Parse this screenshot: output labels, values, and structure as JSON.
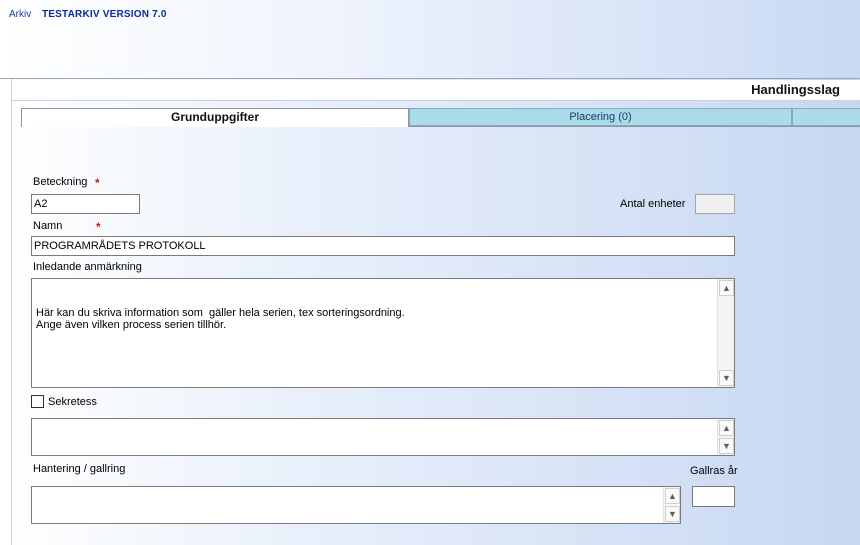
{
  "menu": {
    "arkiv_label": "Arkiv"
  },
  "app": {
    "title": "TESTARKIV VERSION 7.0"
  },
  "header": {
    "title": "Handlingsslag"
  },
  "tabs": [
    {
      "label": "Grunduppgifter",
      "active": true
    },
    {
      "label": "Placering (0)",
      "active": false
    },
    {
      "label": "",
      "active": false
    }
  ],
  "form": {
    "beteckning": {
      "label": "Beteckning",
      "required_mark": "*",
      "value": "A2"
    },
    "antal_enheter": {
      "label": "Antal enheter",
      "value": ""
    },
    "namn": {
      "label": "Namn",
      "required_mark": "*",
      "value": "PROGRAMRÅDETS PROTOKOLL"
    },
    "inledande_anmarkning": {
      "label": "Inledande anmärkning",
      "value": "Här kan du skriva information som  gäller hela serien, tex sorteringsordning.\nAnge även vilken process serien tillhör."
    },
    "sekretess": {
      "label": "Sekretess",
      "checked": false,
      "text_value": ""
    },
    "hantering_gallring": {
      "label": "Hantering / gallring",
      "value": ""
    },
    "gallras_ar": {
      "label": "Gallras år",
      "value": ""
    }
  },
  "icons": {
    "scroll_up": "▲",
    "scroll_down": "▼"
  },
  "colors": {
    "required": "#d01a1a",
    "tab_active_bg": "#ffffff",
    "tab_inactive_bg": "#a9dbe9",
    "title_blue": "#0a2a9a"
  }
}
